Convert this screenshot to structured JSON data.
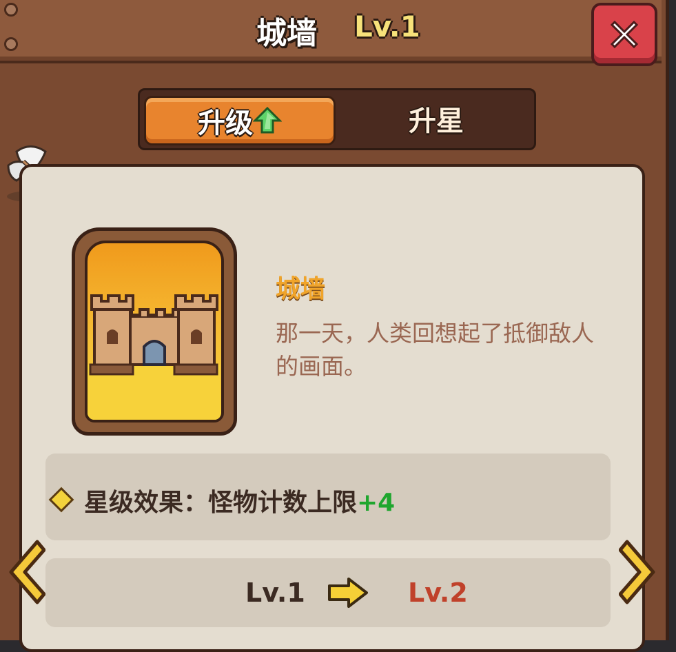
{
  "header": {
    "title": "城墙",
    "level": "Lv.1"
  },
  "tabs": [
    {
      "label": "升级",
      "active": true
    },
    {
      "label": "升星",
      "active": false
    }
  ],
  "item": {
    "name": "城墙",
    "description": "那一天，人类回想起了抵御敌人的画面。"
  },
  "effect": {
    "label": "星级效果：怪物计数上限",
    "value": "+4"
  },
  "level_change": {
    "from": "Lv.1",
    "to": "Lv.2"
  },
  "colors": {
    "accent_orange": "#e8842e",
    "level_gold": "#f7e27a",
    "next_level_red": "#c0412a",
    "bonus_green": "#1fa62e"
  },
  "icons": [
    "close-icon",
    "upgrade-arrow-icon",
    "castle-icon",
    "arrow-right-icon",
    "prev-chevron-icon",
    "next-chevron-icon",
    "feather-arrow-icon",
    "diamond-bullet-icon"
  ]
}
